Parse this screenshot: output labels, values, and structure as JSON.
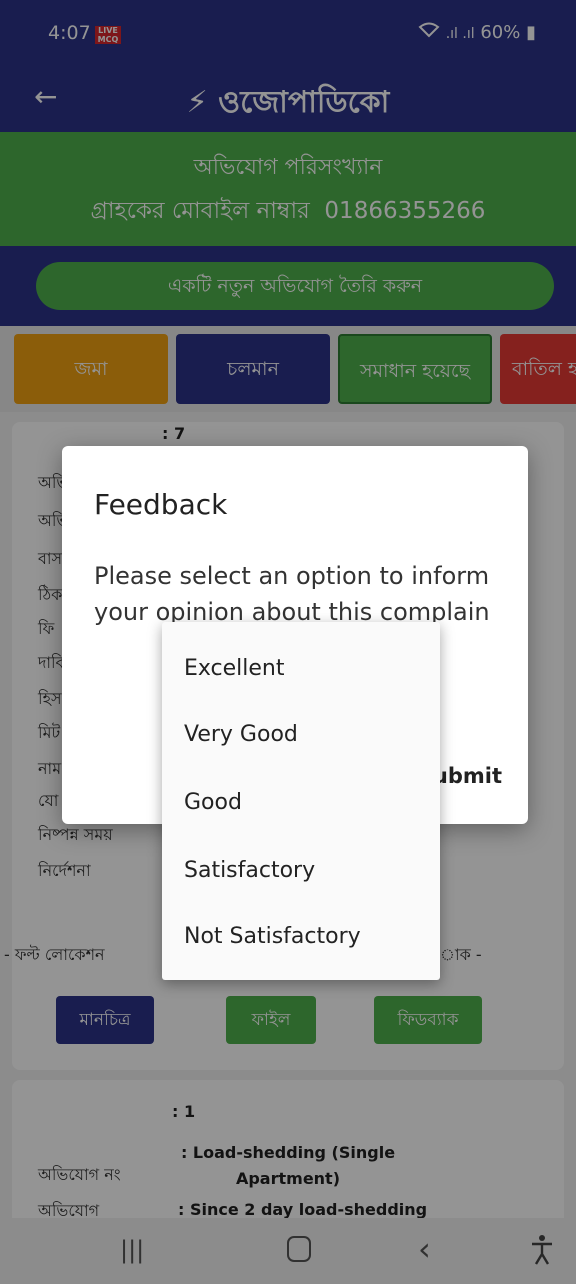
{
  "status": {
    "time": "4:07",
    "live_badge": "LIVE MCQ",
    "right": "60%"
  },
  "appbar": {
    "title": "⚡ ওজোপাডিকো"
  },
  "summary": {
    "title": "অভিযোগ পরিসংখ্যান",
    "mobile_label": "গ্রাহকের মোবাইল নাম্বার",
    "mobile_number": "01866355266"
  },
  "new_complaint_label": "একটি নতুন অভিযোগ তৈরি করুন",
  "tabs": [
    {
      "label": "জমা",
      "color": "#f0a012"
    },
    {
      "label": "চলমান",
      "color": "#2b3389"
    },
    {
      "label": "সমাধান হয়েছে",
      "color": "#4fb04c"
    },
    {
      "label": "বাতিল হ",
      "color": "#e53935"
    }
  ],
  "card1": {
    "first_value": ": 7",
    "labels": [
      "অভি",
      "অভি",
      "বাস",
      "ঠিক",
      "ফি",
      "দাবি",
      "হিস",
      "মিট",
      "নাম",
      "যো",
      "নিষ্পন্ন সময়",
      "নির্দেশনা"
    ],
    "fault_location": "- ফল্ট লোকেশন",
    "right_fragment": "াক -",
    "buttons": [
      {
        "label": "মানচিত্র",
        "color": "#2b3389"
      },
      {
        "label": "ফাইল",
        "color": "#4fb04c"
      },
      {
        "label": "ফিডব্যাক",
        "color": "#4fb04c"
      }
    ]
  },
  "card2": {
    "first_value": ": 1",
    "rows": [
      {
        "label": "অভিযোগ নং",
        "value": ": Load-shedding (Single Apartment)"
      },
      {
        "label": "অভিযোগ",
        "value": ": Since 2 day load-shedding"
      }
    ]
  },
  "dialog": {
    "title": "Feedback",
    "message": "Please select an option to inform your opinion about this complain",
    "submit_label": "Submit"
  },
  "dropdown": {
    "options": [
      "Excellent",
      "Very Good",
      "Good",
      "Satisfactory",
      "Not Satisfactory"
    ]
  },
  "navbar": {
    "recents": "|||",
    "home": "○",
    "back": "‹",
    "accessibility": "☥"
  }
}
